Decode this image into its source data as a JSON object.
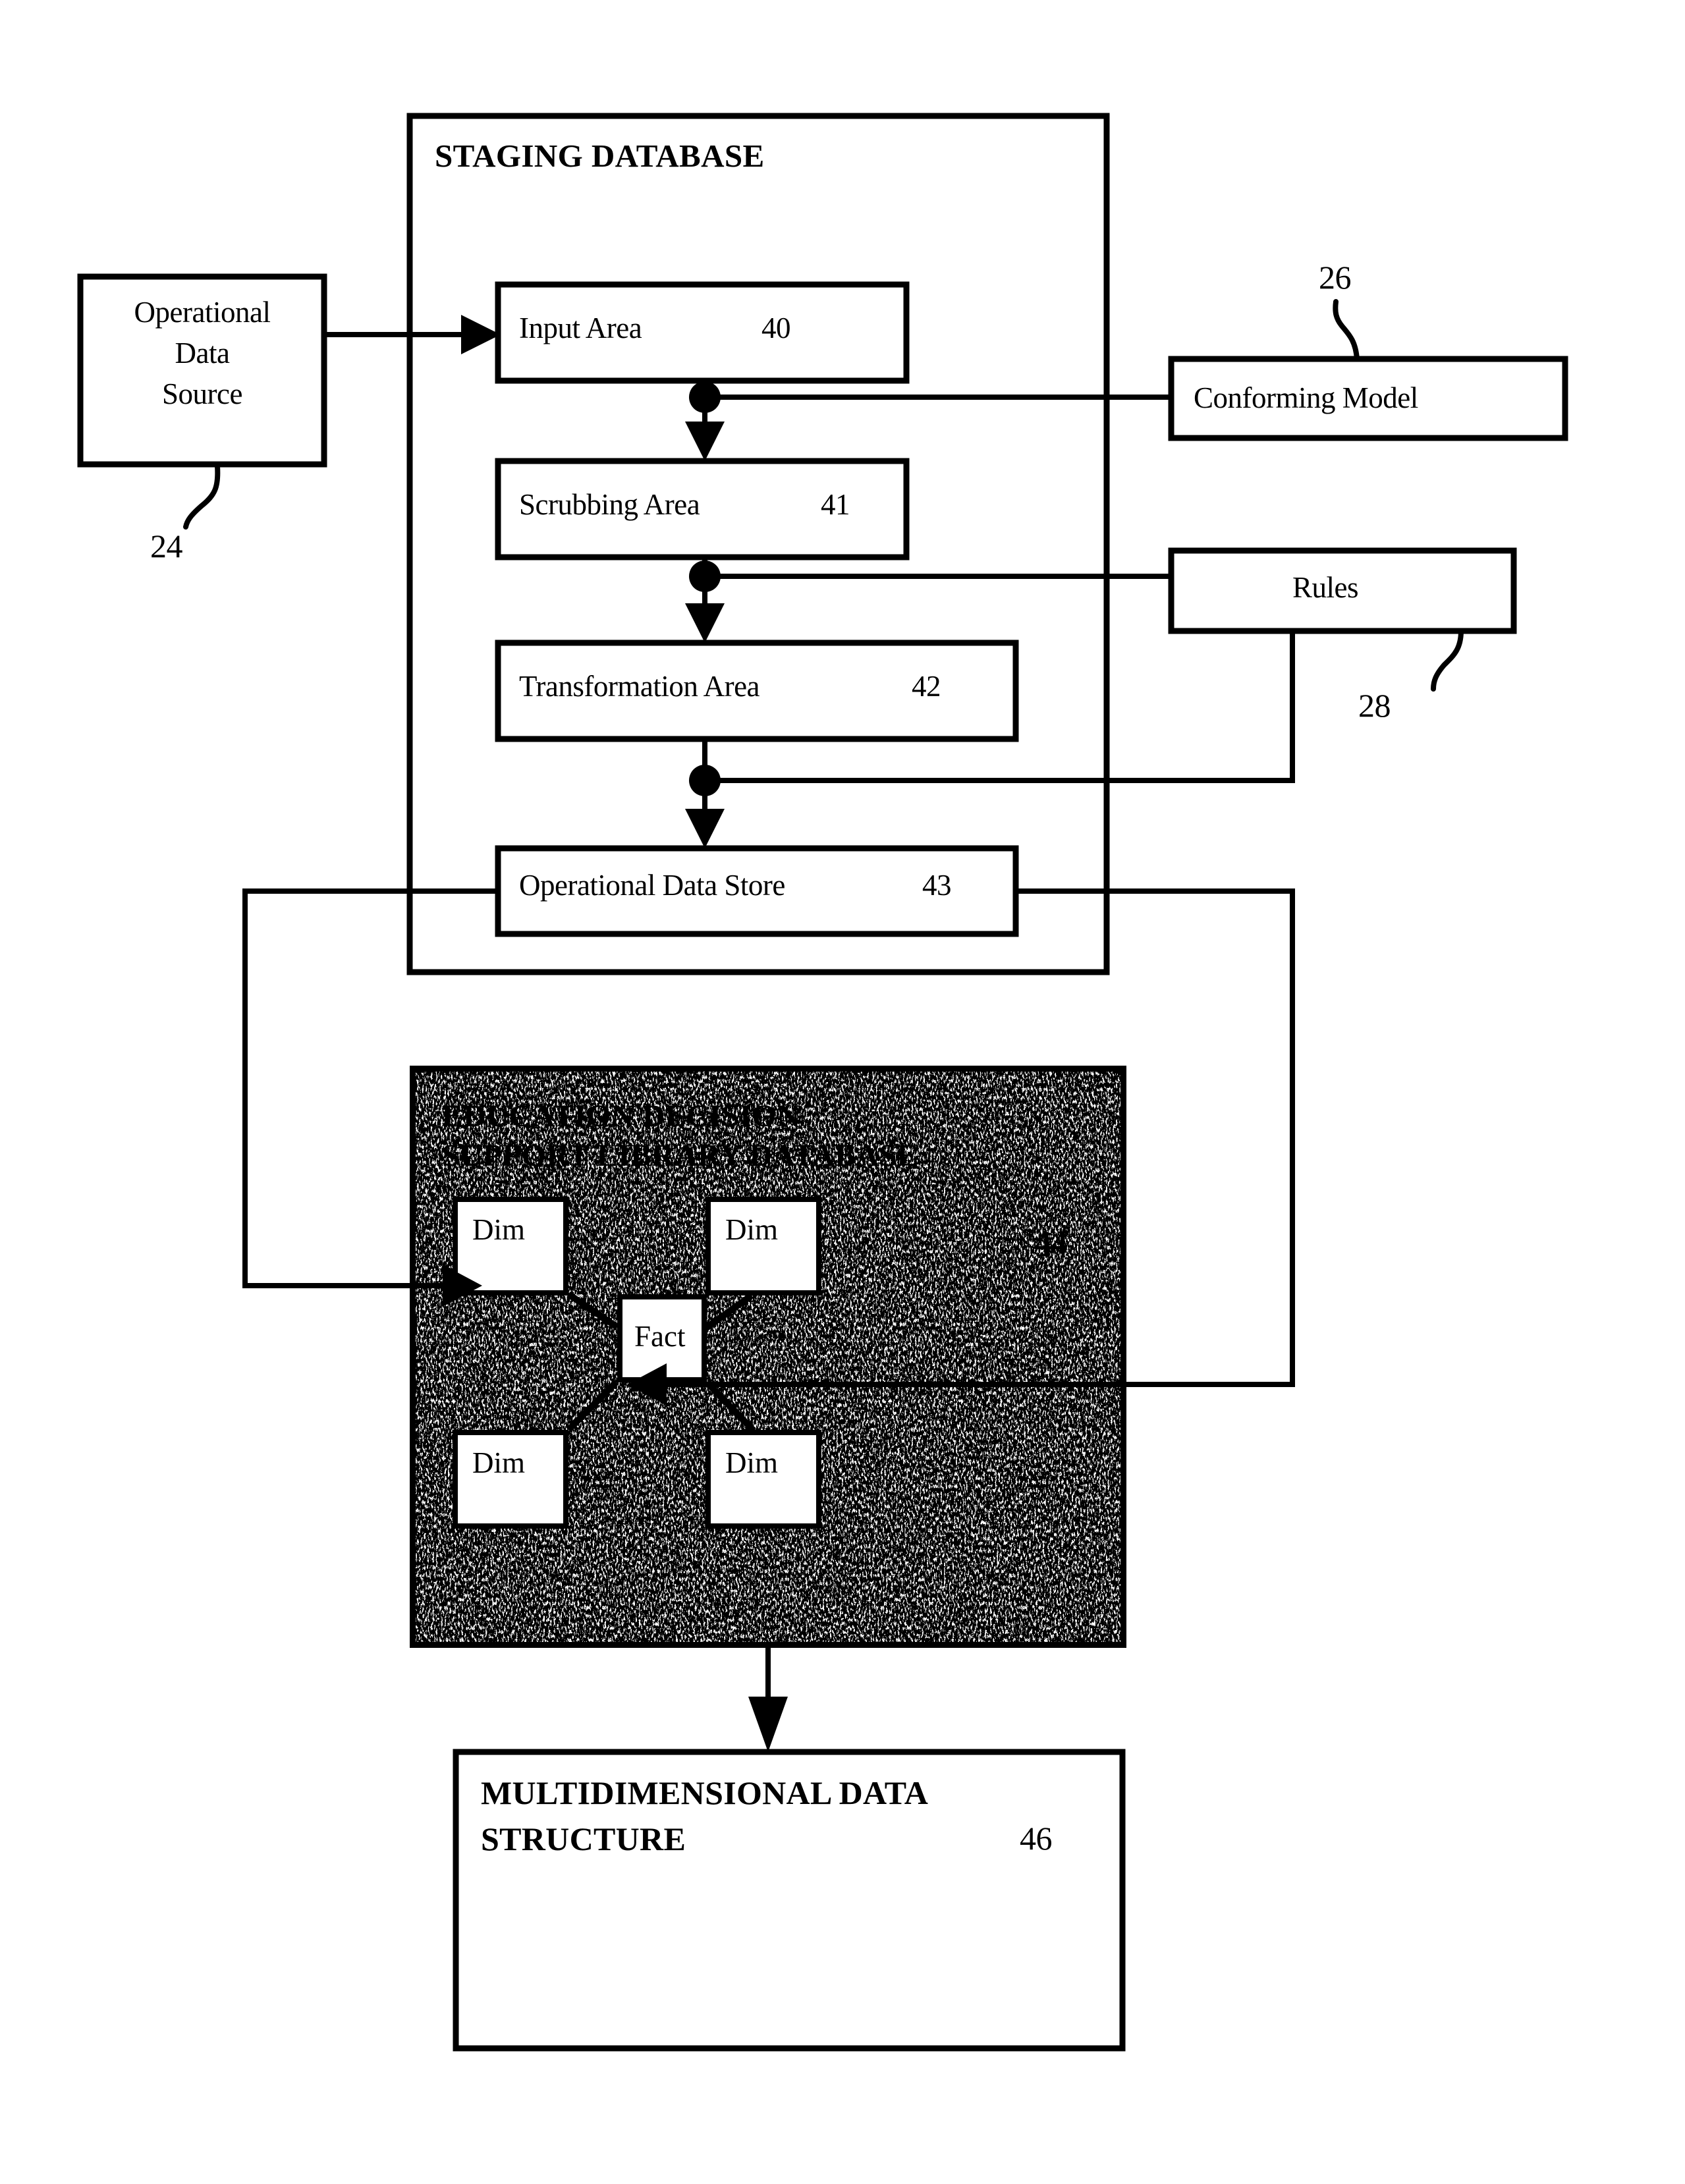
{
  "figure": {
    "staging_database": {
      "title": "STAGING DATABASE",
      "steps": [
        {
          "label": "Input Area",
          "ref": "40"
        },
        {
          "label": "Scrubbing Area",
          "ref": "41"
        },
        {
          "label": "Transformation Area",
          "ref": "42"
        },
        {
          "label": "Operational Data Store",
          "ref": "43"
        }
      ]
    },
    "source": {
      "label_line1": "Operational",
      "label_line2": "Data",
      "label_line3": "Source",
      "ref": "24"
    },
    "conforming_model": {
      "label": "Conforming Model",
      "ref": "26"
    },
    "rules": {
      "label": "Rules",
      "ref": "28"
    },
    "library_database": {
      "title_line1": "EDUCATION DECISION",
      "title_line2": "SUPPORT LIBRARY DATABASE",
      "ref": "44",
      "fact_label": "Fact",
      "dim_labels": [
        "Dim",
        "Dim",
        "Dim",
        "Dim"
      ]
    },
    "multidimensional": {
      "title_line1": "MULTIDIMENSIONAL DATA",
      "title_line2": "STRUCTURE",
      "ref": "46"
    },
    "colors": {
      "ink": "#000000",
      "paper": "#ffffff"
    }
  }
}
